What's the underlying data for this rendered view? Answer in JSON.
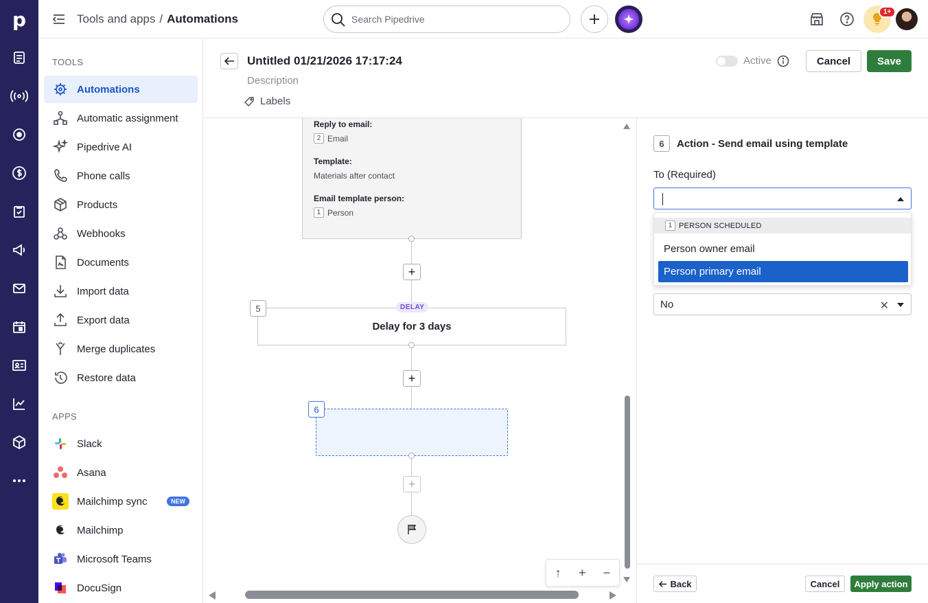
{
  "rail": {
    "logo": "p",
    "icons": [
      "deals-icon",
      "leads-icon",
      "target-icon",
      "dollar-icon",
      "tasks-icon",
      "campaigns-icon",
      "mail-icon",
      "calendar-icon",
      "contacts-icon",
      "insights-icon",
      "products-icon",
      "more-icon"
    ]
  },
  "topbar": {
    "crumb_parent": "Tools and apps",
    "crumb_sep": "/",
    "crumb_current": "Automations",
    "search_placeholder": "Search Pipedrive",
    "notif_badge": "1+"
  },
  "sidebar": {
    "tools_title": "TOOLS",
    "tools": [
      {
        "label": "Automations",
        "icon": "robot-icon",
        "active": true
      },
      {
        "label": "Automatic assignment",
        "icon": "assignment-icon"
      },
      {
        "label": "Pipedrive AI",
        "icon": "sparkle-icon"
      },
      {
        "label": "Phone calls",
        "icon": "phone-icon"
      },
      {
        "label": "Products",
        "icon": "box-icon"
      },
      {
        "label": "Webhooks",
        "icon": "webhook-icon"
      },
      {
        "label": "Documents",
        "icon": "document-icon"
      },
      {
        "label": "Import data",
        "icon": "import-icon"
      },
      {
        "label": "Export data",
        "icon": "export-icon"
      },
      {
        "label": "Merge duplicates",
        "icon": "merge-icon"
      },
      {
        "label": "Restore data",
        "icon": "restore-icon"
      }
    ],
    "apps_title": "APPS",
    "apps": [
      {
        "label": "Slack",
        "icon": "slack-icon"
      },
      {
        "label": "Asana",
        "icon": "asana-icon"
      },
      {
        "label": "Mailchimp sync",
        "icon": "mailchimp-icon",
        "badge": "NEW"
      },
      {
        "label": "Mailchimp",
        "icon": "mailchimp-icon"
      },
      {
        "label": "Microsoft Teams",
        "icon": "teams-icon"
      },
      {
        "label": "DocuSign",
        "icon": "docusign-icon"
      }
    ]
  },
  "header": {
    "title": "Untitled 01/21/2026 17:17:24",
    "description": "Description",
    "labels": "Labels",
    "active_label": "Active",
    "cancel": "Cancel",
    "save": "Save"
  },
  "canvas": {
    "prev_node": {
      "reply_label": "Reply to email:",
      "reply_num": "2",
      "reply_val": "Email",
      "template_label": "Template:",
      "template_val": "Materials after contact",
      "person_label": "Email template person:",
      "person_num": "1",
      "person_val": "Person"
    },
    "delay_node": {
      "step": "5",
      "tag": "DELAY",
      "text": "Delay for 3 days"
    },
    "new_node": {
      "step": "6"
    },
    "zoom": {
      "up": "↑",
      "plus": "+",
      "minus": "−"
    }
  },
  "panel": {
    "step": "6",
    "title": "Action - Send email using template",
    "to_label": "To (Required)",
    "dropdown": {
      "group_num": "1",
      "group_label": "PERSON SCHEDULED",
      "options": [
        "Person owner email",
        "Person primary email"
      ],
      "selected_index": 1
    },
    "second_select_value": "No",
    "back": "Back",
    "cancel": "Cancel",
    "apply": "Apply action"
  },
  "colors": {
    "rail_bg": "#26235c",
    "accent": "#1a55c7",
    "save_green": "#2f7d3c",
    "selected_option": "#1a61c9"
  }
}
